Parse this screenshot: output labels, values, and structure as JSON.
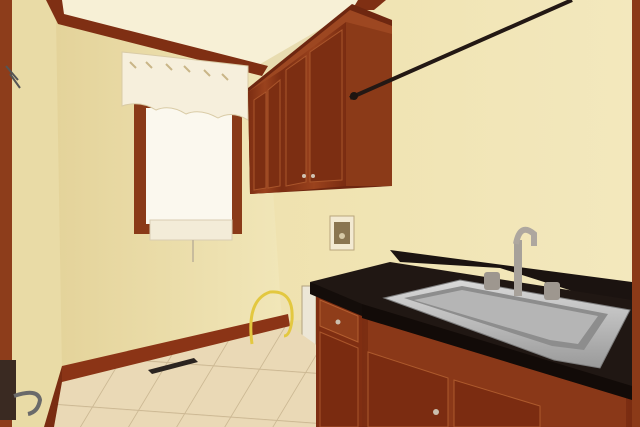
{
  "scene": {
    "description_type": "photo",
    "subject": "laundry room",
    "colors": {
      "wall": "#efe3b4",
      "wall_shadow": "#e2d19c",
      "ceiling": "#f6efd2",
      "wood": "#8a3516",
      "wood_dark": "#5f210c",
      "countertop": "#1c1410",
      "floor_tile": "#e9d9b8",
      "grout": "#cdb996",
      "sink": "#b8b8b8",
      "rod": "#2a1c18"
    },
    "icons": [
      "window-icon",
      "sink-icon",
      "faucet-icon",
      "cabinet-icon",
      "closet-rod-icon",
      "washer-box-icon",
      "floor-vent-icon",
      "water-hose-icon"
    ]
  }
}
